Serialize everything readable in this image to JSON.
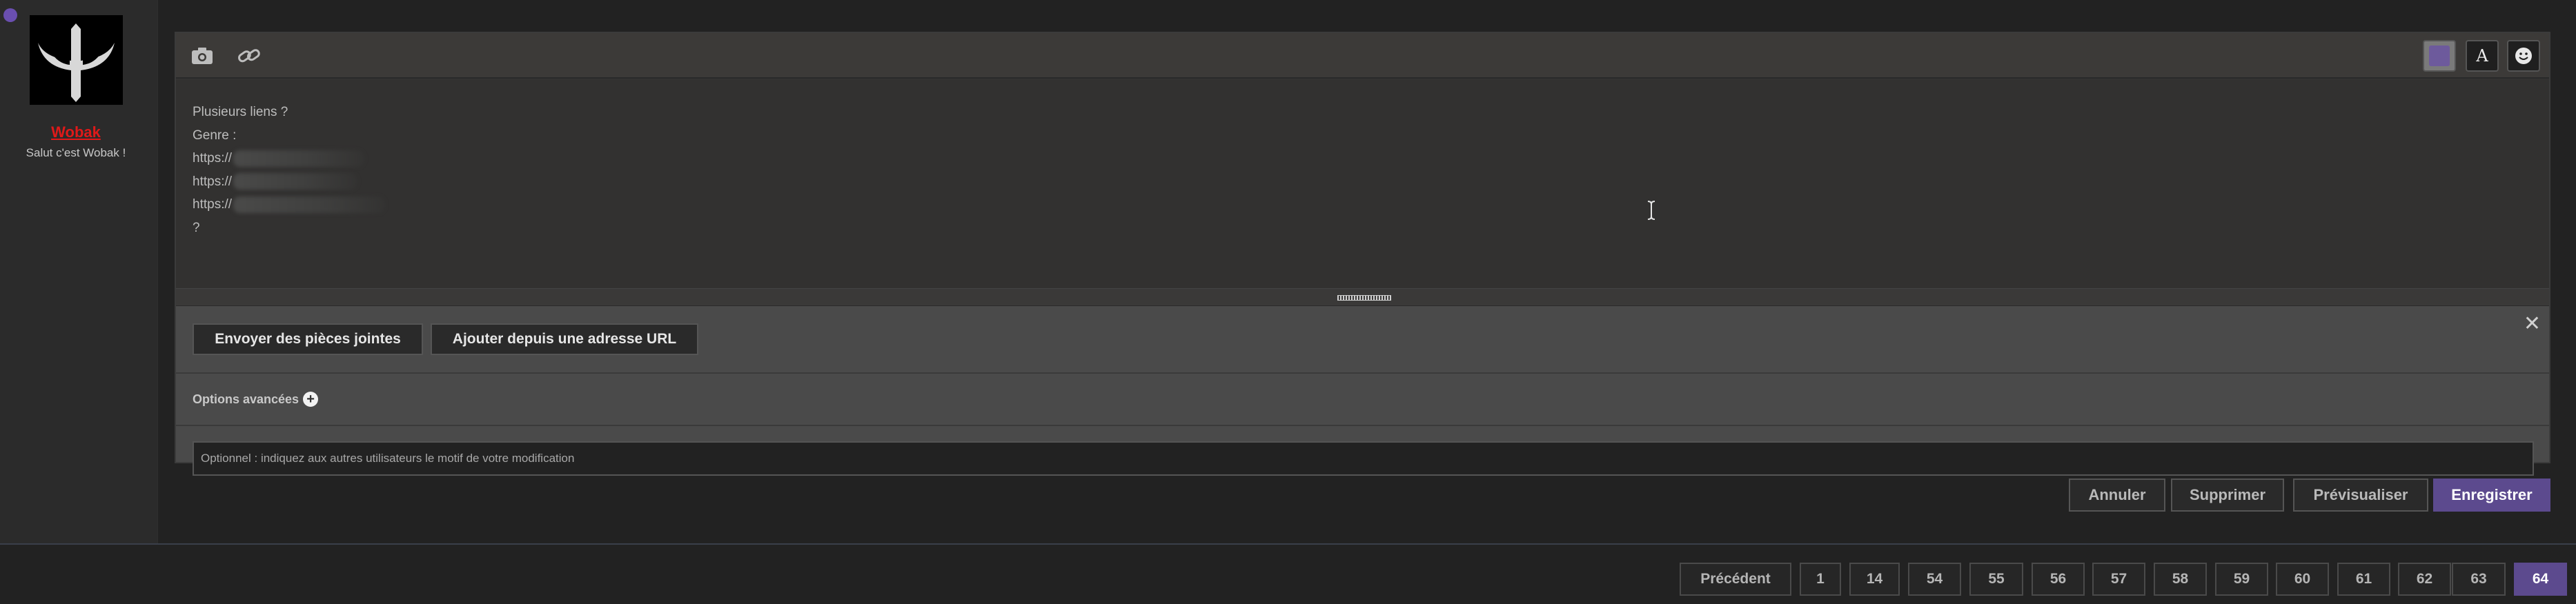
{
  "user": {
    "name": "Wobak",
    "title": "Salut c'est Wobak !"
  },
  "toolbar": {
    "left_icons": [
      "camera-icon",
      "link-icon"
    ],
    "right_buttons": [
      "color-swatch",
      "font-icon",
      "smiley-icon"
    ],
    "font_glyph": "A",
    "color_swatch": "#6d5a9c"
  },
  "editor": {
    "lines": [
      "Plusieurs liens ?",
      "Genre :",
      "https://",
      "https://",
      "https://",
      "?"
    ]
  },
  "attachments": {
    "upload_label": "Envoyer des pièces jointes",
    "url_label": "Ajouter depuis une adresse URL",
    "close_glyph": "✕"
  },
  "options": {
    "label": "Options avancées",
    "toggle_glyph": "+"
  },
  "reason": {
    "placeholder": "Optionnel : indiquez aux autres utilisateurs le motif de votre modification"
  },
  "actions": {
    "cancel": "Annuler",
    "delete": "Supprimer",
    "preview": "Prévisualiser",
    "save": "Enregistrer"
  },
  "pagination": {
    "prev": "Précédent",
    "pages": [
      "1",
      "14",
      "54",
      "55",
      "56",
      "57",
      "58",
      "59",
      "60",
      "61",
      "62",
      "63",
      "64"
    ],
    "current": "64"
  },
  "colors": {
    "accent": "#5c4a8e",
    "username": "#e01919",
    "online": "#6a4fb0"
  }
}
